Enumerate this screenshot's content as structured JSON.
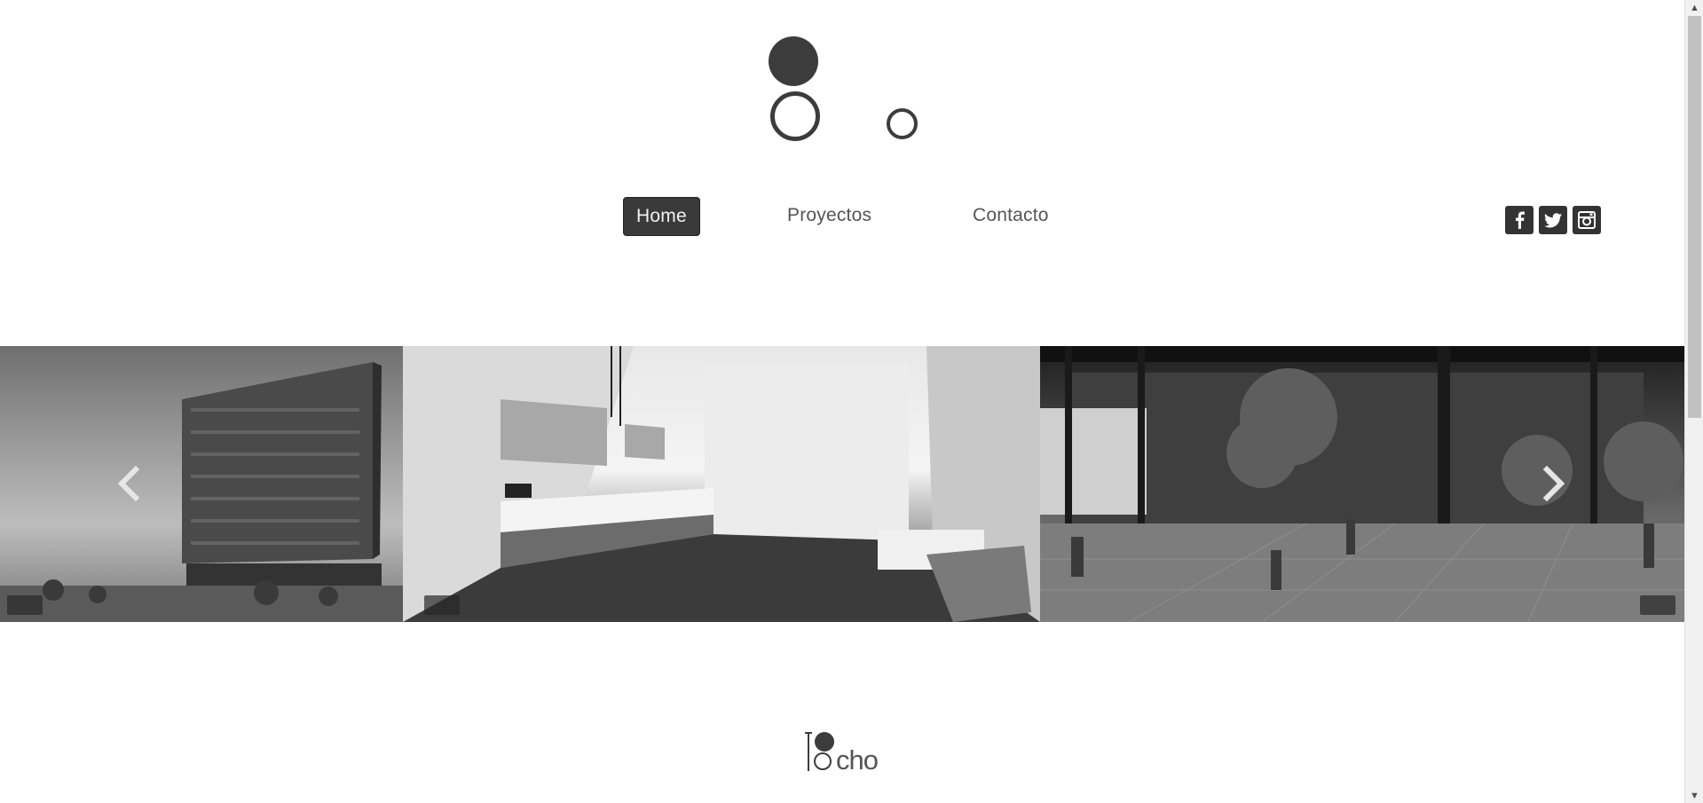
{
  "header": {
    "logo_icon": "ocho-circles-logo"
  },
  "nav": {
    "items": [
      {
        "label": "Home",
        "active": true
      },
      {
        "label": "Proyectos",
        "active": false
      },
      {
        "label": "Contacto",
        "active": false
      }
    ]
  },
  "social": {
    "items": [
      {
        "icon": "facebook-icon",
        "glyph": "f"
      },
      {
        "icon": "twitter-icon",
        "glyph": "twitter"
      },
      {
        "icon": "instagram-icon",
        "glyph": "instagram"
      }
    ]
  },
  "carousel": {
    "slides": [
      {
        "subject": "building-exterior"
      },
      {
        "subject": "bathroom-interior"
      },
      {
        "subject": "courtyard-garden"
      }
    ],
    "prev_icon": "chevron-left-icon",
    "next_icon": "chevron-right-icon"
  },
  "footer": {
    "logo_text": "cho"
  },
  "colors": {
    "accent": "#3a3a3a",
    "text": "#555555",
    "background": "#ffffff"
  }
}
